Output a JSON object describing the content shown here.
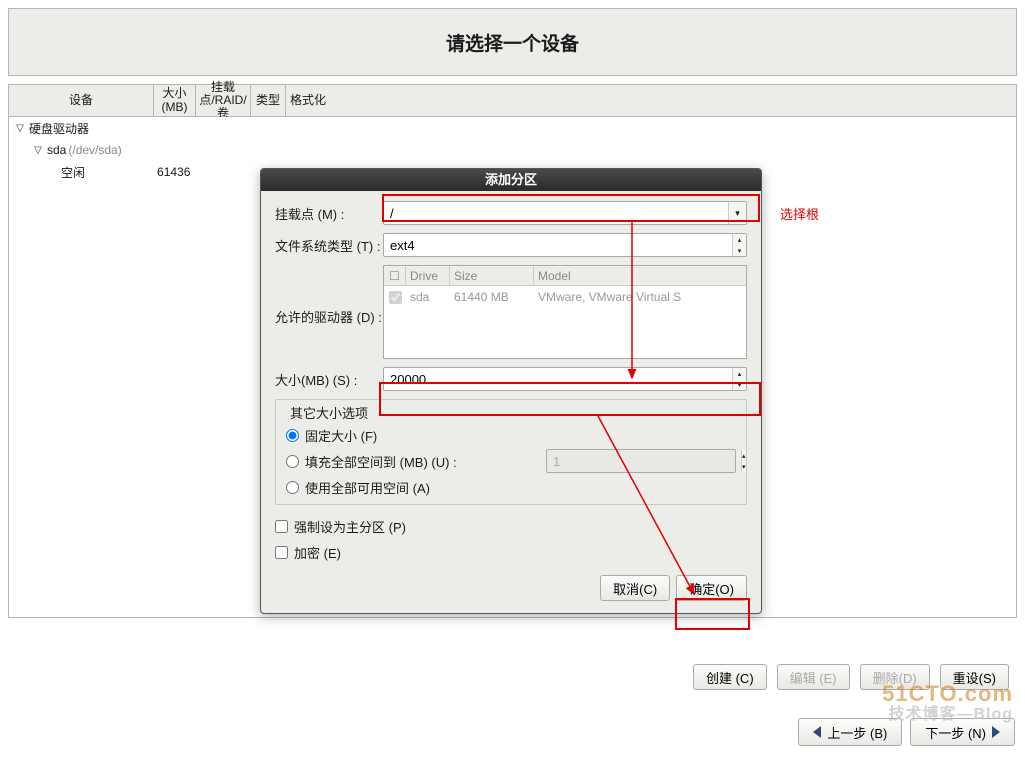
{
  "page": {
    "title": "请选择一个设备"
  },
  "table": {
    "headers": {
      "device": "设备",
      "size": "大小(MB)",
      "mount": "挂载点/RAID/卷",
      "type": "类型",
      "format": "格式化"
    }
  },
  "tree": {
    "root": "硬盘驱动器",
    "sda_label": "sda",
    "sda_dev": "(/dev/sda)",
    "free_label": "空闲",
    "free_size": "61436"
  },
  "dialog": {
    "title": "添加分区",
    "mount_label": "挂载点 (M) :",
    "mount_value": "/",
    "fs_label": "文件系统类型 (T) :",
    "fs_value": "ext4",
    "drives_label": "允许的驱动器 (D) :",
    "drive_headers": {
      "drive": "Drive",
      "size": "Size",
      "model": "Model"
    },
    "drive_row": {
      "name": "sda",
      "size": "61440 MB",
      "model": "VMware, VMware Virtual S"
    },
    "size_label": "大小(MB) (S) :",
    "size_value": "20000",
    "extra_title": "其它大小选项",
    "radio_fixed": "固定大小 (F)",
    "radio_fill_to": "填充全部空间到 (MB) (U) :",
    "radio_fill_all": "使用全部可用空间 (A)",
    "fill_value": "1",
    "check_primary": "强制设为主分区 (P)",
    "check_encrypt": "加密 (E)",
    "cancel": "取消(C)",
    "ok": "确定(O)"
  },
  "bottom": {
    "create": "创建 (C)",
    "edit": "编辑 (E)",
    "delete": "删除(D)",
    "reset": "重设(S)",
    "back": "上一步 (B)",
    "next": "下一步 (N)"
  },
  "annotation": {
    "select_root": "选择根"
  },
  "watermark": {
    "line1": "51CTO.com",
    "line2": "技术博客—Blog"
  }
}
